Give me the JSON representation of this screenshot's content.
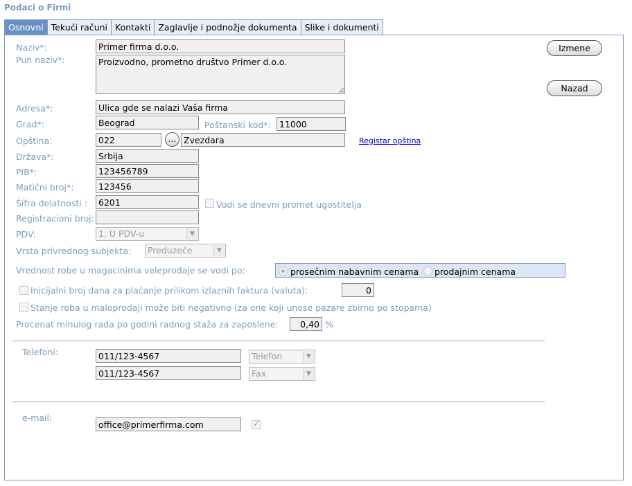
{
  "page_title": "Podaci o Firmi",
  "tabs": [
    {
      "label": "Osnovni",
      "active": true
    },
    {
      "label": "Tekući računi"
    },
    {
      "label": "Kontakti"
    },
    {
      "label": "Zaglavlje i podnožje dokumenta"
    },
    {
      "label": "Slike i dokumenti"
    }
  ],
  "buttons": {
    "izmene": "Izmene",
    "nazad": "Nazad",
    "browse": "..."
  },
  "fields": {
    "naziv": {
      "label": "Naziv*:",
      "value": "Primer firma d.o.o."
    },
    "pun_naziv": {
      "label": "Pun naziv*:",
      "value": "Proizvodno, prometno društvo Primer d.o.o."
    },
    "adresa": {
      "label": "Adresa*:",
      "value": "Ulica gde se nalazi Vaša firma"
    },
    "grad": {
      "label": "Grad*:",
      "value": "Beograd"
    },
    "postanski_kod": {
      "label": "Poštanski kod*:",
      "value": "11000"
    },
    "opstina": {
      "label": "Opština:",
      "code": "022",
      "name": "Zvezdara",
      "link": "Registar opština"
    },
    "drzava": {
      "label": "Država*:",
      "value": "Srbija"
    },
    "pib": {
      "label": "PIB*:",
      "value": "123456789"
    },
    "maticni_broj": {
      "label": "Matični broj*:",
      "value": "123456"
    },
    "sifra_delatnosti": {
      "label": "Šifra delatnosti :",
      "value": "6201",
      "checkbox_label": "Vodi se dnevni promet ugostitelja"
    },
    "registracioni_broj": {
      "label": "Registracioni broj:",
      "value": ""
    },
    "pdv": {
      "label": "PDV:",
      "value": "1. U PDV-u"
    },
    "vrsta_subjekta": {
      "label": "Vrsta privrednog subjekta:",
      "value": "Preduzeće"
    },
    "vrednost_robe": {
      "label": "Vrednost robe u magacinima veleprodaje se vodi po:",
      "option_1": "prosečnim nabavnim cenama",
      "option_2": "prodajnim cenama",
      "selected": "option_1"
    },
    "inicijalni_broj_dana": {
      "label": "Inicijalni broj dana za plaćanje prilikom izlaznih faktura (valuta):",
      "value": "0"
    },
    "stanje_robe": {
      "label": "Stanje roba u maloprodaji može biti negativno (za one koji unose pazare zbirno po stopama)"
    },
    "procenat_minulog_rada": {
      "label": "Procenat minulog rada po godini radnog staža za zaposlene:",
      "value": "0,40",
      "unit": "%"
    }
  },
  "telefoni": {
    "label": "Telefoni:",
    "items": [
      {
        "number": "011/123-4567",
        "type": "Telefon"
      },
      {
        "number": "011/123-4567",
        "type": "Fax"
      }
    ]
  },
  "email": {
    "label": "e-mail:",
    "value": "office@primerfirma.com",
    "checked": true
  }
}
